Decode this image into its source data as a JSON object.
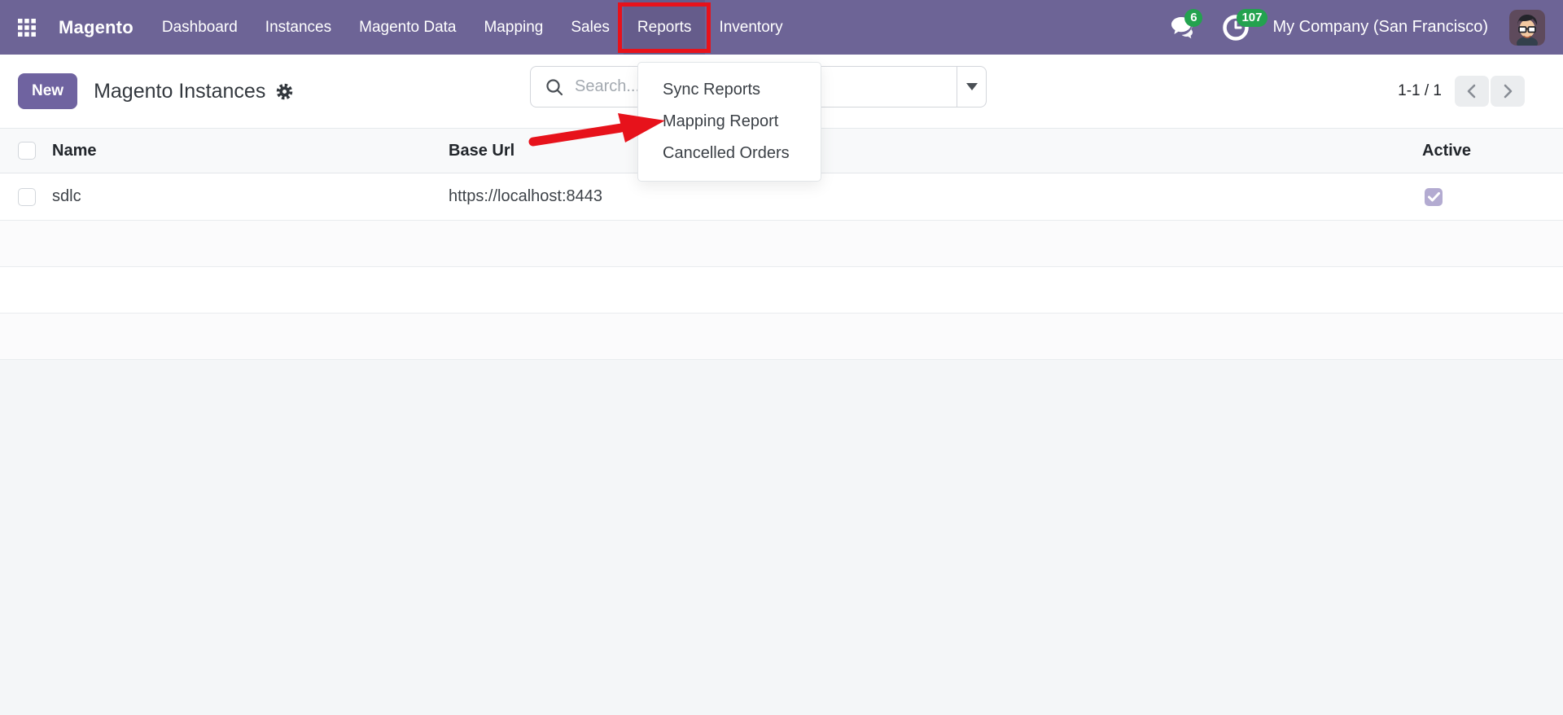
{
  "topbar": {
    "brand": "Magento",
    "nav": [
      "Dashboard",
      "Instances",
      "Magento Data",
      "Mapping",
      "Sales",
      "Reports",
      "Inventory"
    ],
    "active_nav": "Reports",
    "messages_badge": "6",
    "activities_badge": "107",
    "company": "My Company (San Francisco)"
  },
  "control_panel": {
    "new_button_label": "New",
    "title": "Magento Instances",
    "search_placeholder": "Search...",
    "pager_text": "1-1 / 1"
  },
  "reports_menu": {
    "items": [
      "Sync Reports",
      "Mapping Report",
      "Cancelled Orders"
    ]
  },
  "table": {
    "columns": [
      "Name",
      "Base Url",
      "Active"
    ],
    "rows": [
      {
        "name": "sdlc",
        "base_url": "https://localhost:8443",
        "active": true
      }
    ]
  },
  "annotations": {
    "highlighted_nav": "Reports",
    "arrow_points_to": "Mapping Report",
    "annotation_color": "#e7121b"
  },
  "colors": {
    "topbar_bg": "#6d6496",
    "primary_button_bg": "#6f63a0",
    "badge_green": "#23a24f",
    "active_checkbox": "#b3abd1",
    "header_row_bg": "#f8f9fa"
  }
}
